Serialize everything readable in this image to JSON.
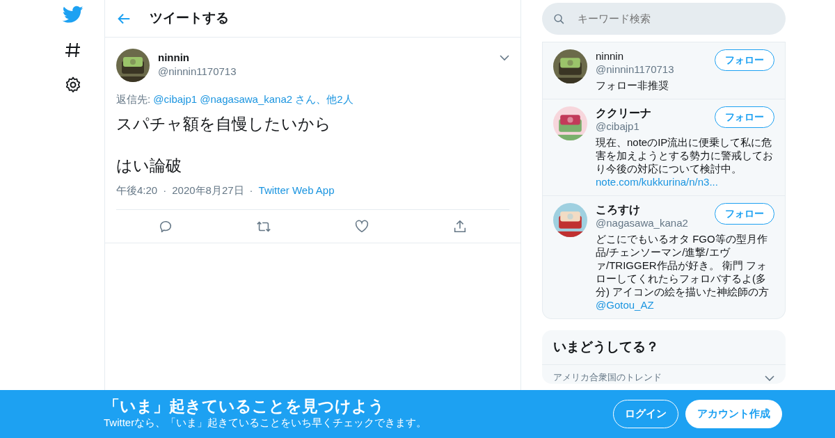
{
  "header": {
    "title": "ツイートする"
  },
  "tweet": {
    "name": "ninnin",
    "handle": "@ninnin1170713",
    "reply_label": "返信先:",
    "reply_to": [
      "@cibajp1",
      "@nagasawa_kana2"
    ],
    "reply_others": "さん、他2人",
    "lines": [
      "スパチャ額を自慢したいから",
      "はい論破"
    ],
    "time": "午後4:20",
    "separator": "·",
    "date": "2020年8月27日",
    "source": "Twitter Web App"
  },
  "search": {
    "placeholder": "キーワード検索"
  },
  "users": [
    {
      "name": "ninnin",
      "handle": "@ninnin1170713",
      "bio": "フォロー非推奨",
      "button": "フォロー",
      "bold_name": false
    },
    {
      "name": "ククリーナ",
      "handle": "@cibajp1",
      "bio": "現在、noteのIP流出に便乗して私に危害を加えようとする勢力に警戒しており今後の対応について検討中。",
      "link": "note.com/kukkurina/n/n3...",
      "button": "フォロー",
      "bold_name": true
    },
    {
      "name": "ころすけ",
      "handle": "@nagasawa_kana2",
      "bio": "どこにでもいるオタ FGO等の型月作品/チェンソーマン/進撃/エヴァ/TRIGGER作品が好き。 衛門 フォローしてくれたらフォロバするよ(多分) アイコンの絵を描いた神絵師の方",
      "link": "@Gotou_AZ",
      "button": "フォロー",
      "bold_name": true
    }
  ],
  "trends": {
    "title": "いまどうしてる？",
    "items": [
      {
        "context": "アメリカ合衆国のトレンド"
      }
    ]
  },
  "banner": {
    "title": "「いま」起きていることを見つけよう",
    "subtitle": "Twitterなら、「いま」起きていることをいち早くチェックできます。",
    "login": "ログイン",
    "signup": "アカウント作成"
  }
}
